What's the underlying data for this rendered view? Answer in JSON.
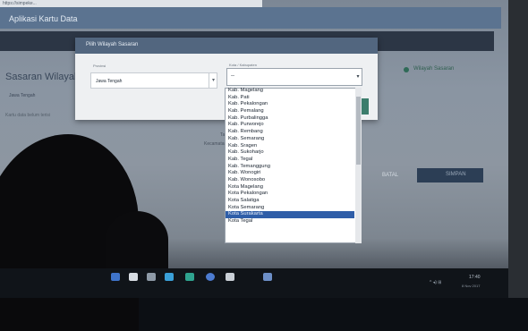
{
  "browser": {
    "address_text": "https://simpeke..."
  },
  "app": {
    "title": "Aplikasi Kartu Data"
  },
  "background": {
    "heading": "Sasaran Wilayah Penyuluhan",
    "sub_left": "Jawa Tengah",
    "sub_left2": "Kartu data belum terisi",
    "mid_text1": "Target",
    "mid_text2": "Kecamatan",
    "right_link": "Wilayah Sasaran",
    "batal_label": "BATAL",
    "primary_button_label": "SIMPAN"
  },
  "modal": {
    "title": "Pilih Wilayah Sasaran",
    "provinsi_label": "Provinsi",
    "provinsi_value": "Jawa Tengah",
    "kota_label": "Kota / Kabupaten",
    "kota_value": "--",
    "caret": "▾"
  },
  "dropdown": {
    "items": [
      "Kab. Magelang",
      "Kab. Pati",
      "Kab. Pekalongan",
      "Kab. Pemalang",
      "Kab. Purbalingga",
      "Kab. Purworejo",
      "Kab. Rembang",
      "Kab. Semarang",
      "Kab. Sragen",
      "Kab. Sukoharjo",
      "Kab. Tegal",
      "Kab. Temanggung",
      "Kab. Wonogiri",
      "Kab. Wonosobo",
      "Kota Magelang",
      "Kota Pekalongan",
      "Kota Salatiga",
      "Kota Semarang",
      "Kota Surakarta",
      "Kota Tegal"
    ],
    "selected_index": 18
  },
  "taskbar": {
    "time": "17:40",
    "date": "8 Nov 2017",
    "tray_text": "^ ◂) ⊞"
  },
  "colors": {
    "accent": "#2f5ea8",
    "appbar": "#5b7390",
    "modal_header": "#52667f"
  }
}
